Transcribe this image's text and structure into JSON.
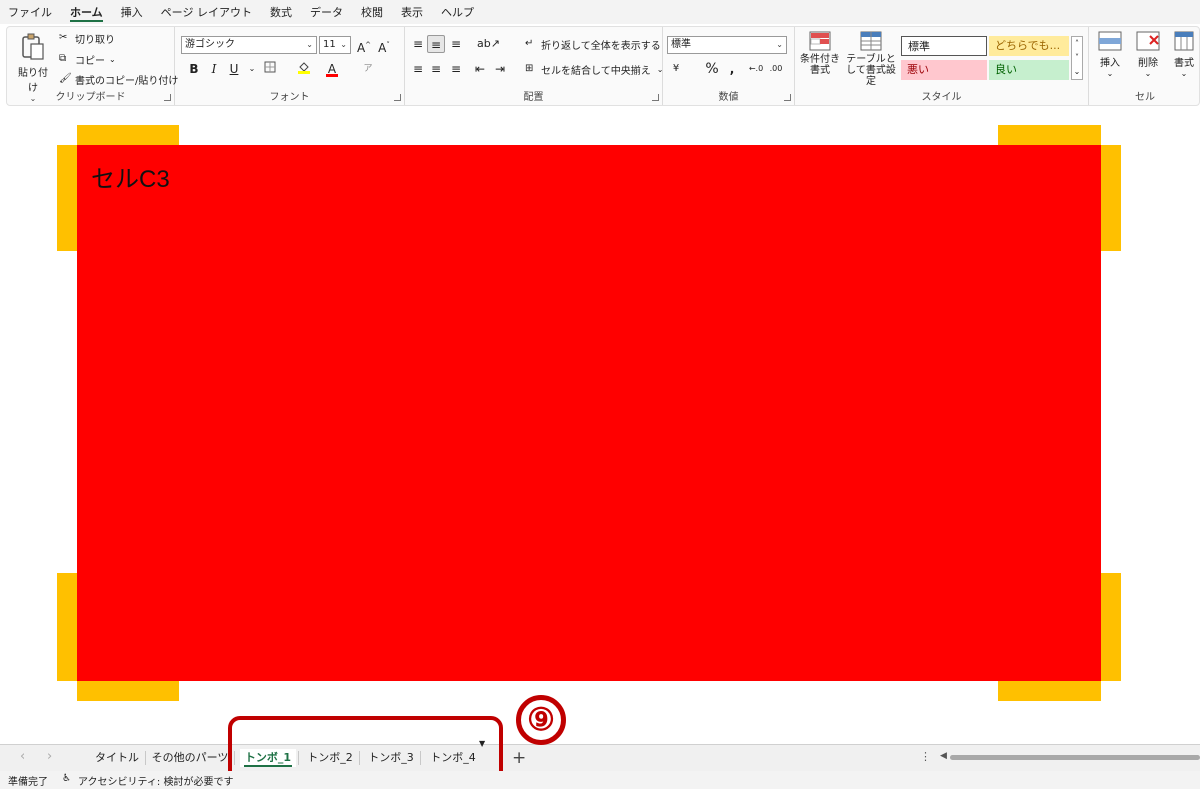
{
  "menu": {
    "tabs": [
      "ファイル",
      "ホーム",
      "挿入",
      "ページ レイアウト",
      "数式",
      "データ",
      "校閲",
      "表示",
      "ヘルプ"
    ]
  },
  "ribbon": {
    "clipboard": {
      "paste_label": "貼り付け",
      "cut_label": "切り取り",
      "copy_label": "コピー",
      "format_painter_label": "書式のコピー/貼り付け",
      "group_label": "クリップボード"
    },
    "font": {
      "font_name": "游ゴシック",
      "font_size": "11",
      "bold": "B",
      "italic": "I",
      "underline": "U",
      "group_label": "フォント"
    },
    "alignment": {
      "wrap_text_label": "折り返して全体を表示する",
      "merge_center_label": "セルを結合して中央揃え",
      "group_label": "配置"
    },
    "number": {
      "format_value": "標準",
      "percent": "%",
      "comma": "\u0019",
      "group_label": "数値"
    },
    "styles": {
      "conditional_formatting_label": "条件付き書式",
      "format_as_table_label": "テーブルとして書式設定",
      "style_normal": "標準",
      "style_neutral": "どちらでも...",
      "style_bad": "悪い",
      "style_good": "良い",
      "group_label": "スタイル"
    },
    "cells": {
      "insert_label": "挿入",
      "delete_label": "削除",
      "format_label": "書式",
      "group_label": "セル"
    }
  },
  "sheet": {
    "cell_text": "セルC3",
    "annotation_number": "⑨"
  },
  "sheet_tabs": {
    "tabs": [
      "タイトル",
      "その他のパーツ",
      "トンボ_1",
      "トンボ_2",
      "トンボ_3",
      "トンボ_4"
    ],
    "active_tab": "トンボ_1"
  },
  "status": {
    "ready": "準備完了",
    "accessibility": "アクセシビリティ: 検討が必要です"
  },
  "colors": {
    "accent_green": "#1e7145",
    "red_fill": "#ff0000",
    "corner_mark": "#ffc000",
    "highlight_red": "#c00000"
  }
}
